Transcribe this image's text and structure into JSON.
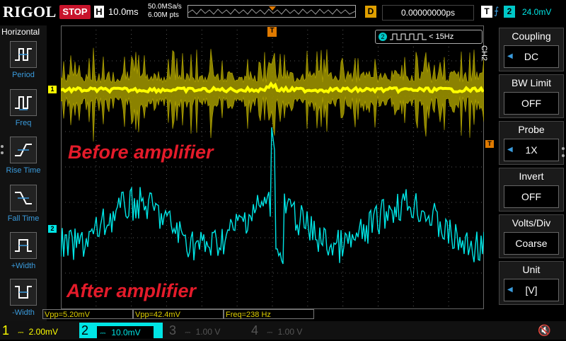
{
  "top": {
    "brand": "RIGOL",
    "run_state": "STOP",
    "timebase_key": "H",
    "timebase": "10.0ms",
    "sample_rate": "50.0MSa/s",
    "mem_depth": "6.00M pts",
    "delay_key": "D",
    "delay": "0.00000000ps",
    "trigger_key": "T",
    "trigger_level": "24.0mV"
  },
  "left_panel": {
    "title": "Horizontal",
    "items": [
      {
        "label": "Period",
        "icon": "period-icon"
      },
      {
        "label": "Freq",
        "icon": "freq-icon"
      },
      {
        "label": "Rise Time",
        "icon": "rise-time-icon"
      },
      {
        "label": "Fall Time",
        "icon": "fall-time-icon"
      },
      {
        "label": "+Width",
        "icon": "pos-width-icon"
      },
      {
        "label": "-Width",
        "icon": "neg-width-icon"
      }
    ]
  },
  "screen": {
    "ch2_freq_badge": "< 15Hz",
    "ch1_marker": "1",
    "ch2_marker": "2",
    "trig_marker": "T",
    "label_before": "Before amplifier",
    "label_after": "After amplifier"
  },
  "right_panel": {
    "channel_tag": "CH2",
    "items": [
      {
        "title": "Coupling",
        "value": "DC"
      },
      {
        "title": "BW Limit",
        "value": "OFF"
      },
      {
        "title": "Probe",
        "value": "1X"
      },
      {
        "title": "Invert",
        "value": "OFF"
      },
      {
        "title": "Volts/Div",
        "value": "Coarse"
      },
      {
        "title": "Unit",
        "value": "[V]"
      }
    ]
  },
  "measurements": [
    {
      "text": "Vpp=5.20mV"
    },
    {
      "text": "Vpp=42.4mV"
    },
    {
      "text": "Freq=238 Hz"
    }
  ],
  "channels": [
    {
      "num": "1",
      "scale": "2.00mV",
      "color": "#ffff00"
    },
    {
      "num": "2",
      "scale": "10.0mV",
      "color": "#00e5e5"
    },
    {
      "num": "3",
      "scale": "1.00 V",
      "color": "#c000c0"
    },
    {
      "num": "4",
      "scale": "1.00 V",
      "color": "#3a6cff"
    }
  ],
  "colors": {
    "ch1": "#ffff00",
    "ch2": "#00e5e5",
    "accent": "#3a9bdc",
    "stop": "#c8142c",
    "label_red": "#e41b2a"
  }
}
